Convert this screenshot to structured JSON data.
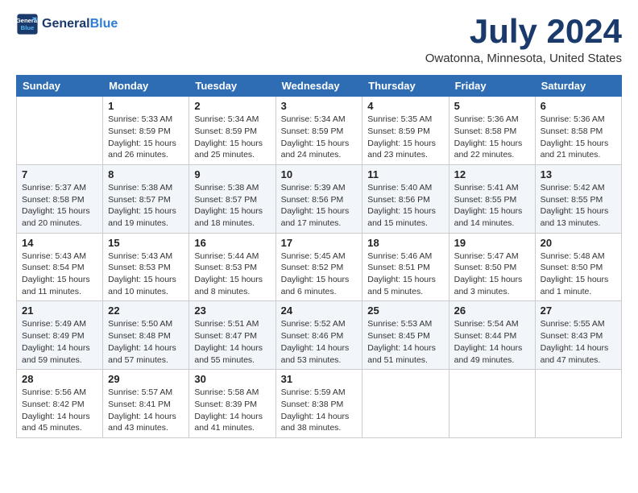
{
  "header": {
    "logo_line1": "General",
    "logo_line2": "Blue",
    "month_title": "July 2024",
    "location": "Owatonna, Minnesota, United States"
  },
  "weekdays": [
    "Sunday",
    "Monday",
    "Tuesday",
    "Wednesday",
    "Thursday",
    "Friday",
    "Saturday"
  ],
  "weeks": [
    [
      {
        "day": "",
        "info": ""
      },
      {
        "day": "1",
        "info": "Sunrise: 5:33 AM\nSunset: 8:59 PM\nDaylight: 15 hours\nand 26 minutes."
      },
      {
        "day": "2",
        "info": "Sunrise: 5:34 AM\nSunset: 8:59 PM\nDaylight: 15 hours\nand 25 minutes."
      },
      {
        "day": "3",
        "info": "Sunrise: 5:34 AM\nSunset: 8:59 PM\nDaylight: 15 hours\nand 24 minutes."
      },
      {
        "day": "4",
        "info": "Sunrise: 5:35 AM\nSunset: 8:59 PM\nDaylight: 15 hours\nand 23 minutes."
      },
      {
        "day": "5",
        "info": "Sunrise: 5:36 AM\nSunset: 8:58 PM\nDaylight: 15 hours\nand 22 minutes."
      },
      {
        "day": "6",
        "info": "Sunrise: 5:36 AM\nSunset: 8:58 PM\nDaylight: 15 hours\nand 21 minutes."
      }
    ],
    [
      {
        "day": "7",
        "info": "Sunrise: 5:37 AM\nSunset: 8:58 PM\nDaylight: 15 hours\nand 20 minutes."
      },
      {
        "day": "8",
        "info": "Sunrise: 5:38 AM\nSunset: 8:57 PM\nDaylight: 15 hours\nand 19 minutes."
      },
      {
        "day": "9",
        "info": "Sunrise: 5:38 AM\nSunset: 8:57 PM\nDaylight: 15 hours\nand 18 minutes."
      },
      {
        "day": "10",
        "info": "Sunrise: 5:39 AM\nSunset: 8:56 PM\nDaylight: 15 hours\nand 17 minutes."
      },
      {
        "day": "11",
        "info": "Sunrise: 5:40 AM\nSunset: 8:56 PM\nDaylight: 15 hours\nand 15 minutes."
      },
      {
        "day": "12",
        "info": "Sunrise: 5:41 AM\nSunset: 8:55 PM\nDaylight: 15 hours\nand 14 minutes."
      },
      {
        "day": "13",
        "info": "Sunrise: 5:42 AM\nSunset: 8:55 PM\nDaylight: 15 hours\nand 13 minutes."
      }
    ],
    [
      {
        "day": "14",
        "info": "Sunrise: 5:43 AM\nSunset: 8:54 PM\nDaylight: 15 hours\nand 11 minutes."
      },
      {
        "day": "15",
        "info": "Sunrise: 5:43 AM\nSunset: 8:53 PM\nDaylight: 15 hours\nand 10 minutes."
      },
      {
        "day": "16",
        "info": "Sunrise: 5:44 AM\nSunset: 8:53 PM\nDaylight: 15 hours\nand 8 minutes."
      },
      {
        "day": "17",
        "info": "Sunrise: 5:45 AM\nSunset: 8:52 PM\nDaylight: 15 hours\nand 6 minutes."
      },
      {
        "day": "18",
        "info": "Sunrise: 5:46 AM\nSunset: 8:51 PM\nDaylight: 15 hours\nand 5 minutes."
      },
      {
        "day": "19",
        "info": "Sunrise: 5:47 AM\nSunset: 8:50 PM\nDaylight: 15 hours\nand 3 minutes."
      },
      {
        "day": "20",
        "info": "Sunrise: 5:48 AM\nSunset: 8:50 PM\nDaylight: 15 hours\nand 1 minute."
      }
    ],
    [
      {
        "day": "21",
        "info": "Sunrise: 5:49 AM\nSunset: 8:49 PM\nDaylight: 14 hours\nand 59 minutes."
      },
      {
        "day": "22",
        "info": "Sunrise: 5:50 AM\nSunset: 8:48 PM\nDaylight: 14 hours\nand 57 minutes."
      },
      {
        "day": "23",
        "info": "Sunrise: 5:51 AM\nSunset: 8:47 PM\nDaylight: 14 hours\nand 55 minutes."
      },
      {
        "day": "24",
        "info": "Sunrise: 5:52 AM\nSunset: 8:46 PM\nDaylight: 14 hours\nand 53 minutes."
      },
      {
        "day": "25",
        "info": "Sunrise: 5:53 AM\nSunset: 8:45 PM\nDaylight: 14 hours\nand 51 minutes."
      },
      {
        "day": "26",
        "info": "Sunrise: 5:54 AM\nSunset: 8:44 PM\nDaylight: 14 hours\nand 49 minutes."
      },
      {
        "day": "27",
        "info": "Sunrise: 5:55 AM\nSunset: 8:43 PM\nDaylight: 14 hours\nand 47 minutes."
      }
    ],
    [
      {
        "day": "28",
        "info": "Sunrise: 5:56 AM\nSunset: 8:42 PM\nDaylight: 14 hours\nand 45 minutes."
      },
      {
        "day": "29",
        "info": "Sunrise: 5:57 AM\nSunset: 8:41 PM\nDaylight: 14 hours\nand 43 minutes."
      },
      {
        "day": "30",
        "info": "Sunrise: 5:58 AM\nSunset: 8:39 PM\nDaylight: 14 hours\nand 41 minutes."
      },
      {
        "day": "31",
        "info": "Sunrise: 5:59 AM\nSunset: 8:38 PM\nDaylight: 14 hours\nand 38 minutes."
      },
      {
        "day": "",
        "info": ""
      },
      {
        "day": "",
        "info": ""
      },
      {
        "day": "",
        "info": ""
      }
    ]
  ]
}
